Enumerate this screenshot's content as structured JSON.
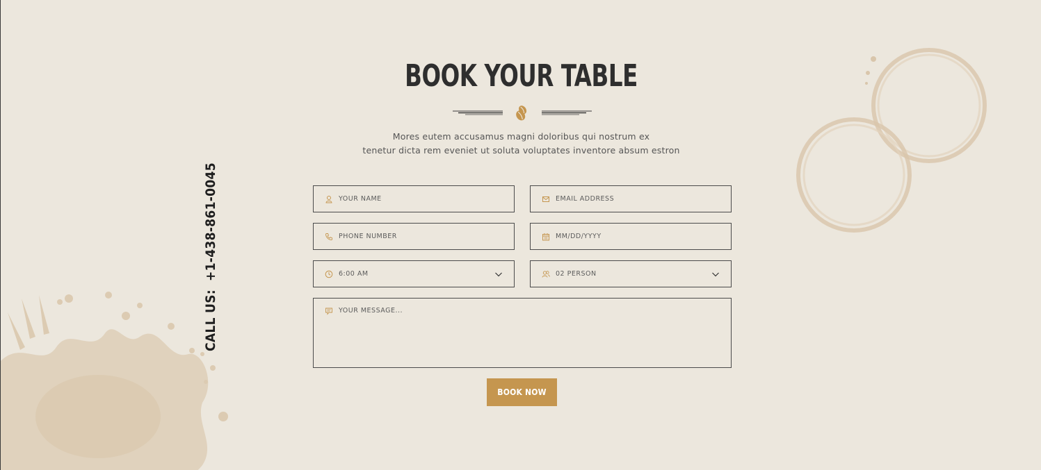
{
  "colors": {
    "background": "#ece7dd",
    "accent": "#c5964f",
    "heading": "#2e2e2e",
    "border": "#4a4a4a",
    "stain": "#d9c8b0"
  },
  "call_us": {
    "label": "CALL US:",
    "phone": "+1-438-861-0045"
  },
  "header": {
    "title": "BOOK YOUR TABLE",
    "divider_icon": "coffee-bean-icon",
    "subtitle_line1": "Mores eutem accusamus magni doloribus qui nostrum ex",
    "subtitle_line2": "tenetur dicta rem eveniet ut soluta voluptates inventore absum estron"
  },
  "form": {
    "name": {
      "placeholder": "YOUR NAME",
      "icon": "user-icon"
    },
    "email": {
      "placeholder": "EMAIL ADDRESS",
      "icon": "envelope-icon"
    },
    "phone": {
      "placeholder": "PHONE NUMBER",
      "icon": "phone-icon"
    },
    "date": {
      "placeholder": "MM/DD/YYYY",
      "icon": "calendar-icon"
    },
    "time": {
      "value": "6:00 AM",
      "icon": "clock-icon"
    },
    "persons": {
      "value": "02 PERSON",
      "icon": "users-icon"
    },
    "message": {
      "placeholder": "YOUR MESSAGE...",
      "icon": "message-icon"
    },
    "submit_label": "BOOK NOW"
  }
}
